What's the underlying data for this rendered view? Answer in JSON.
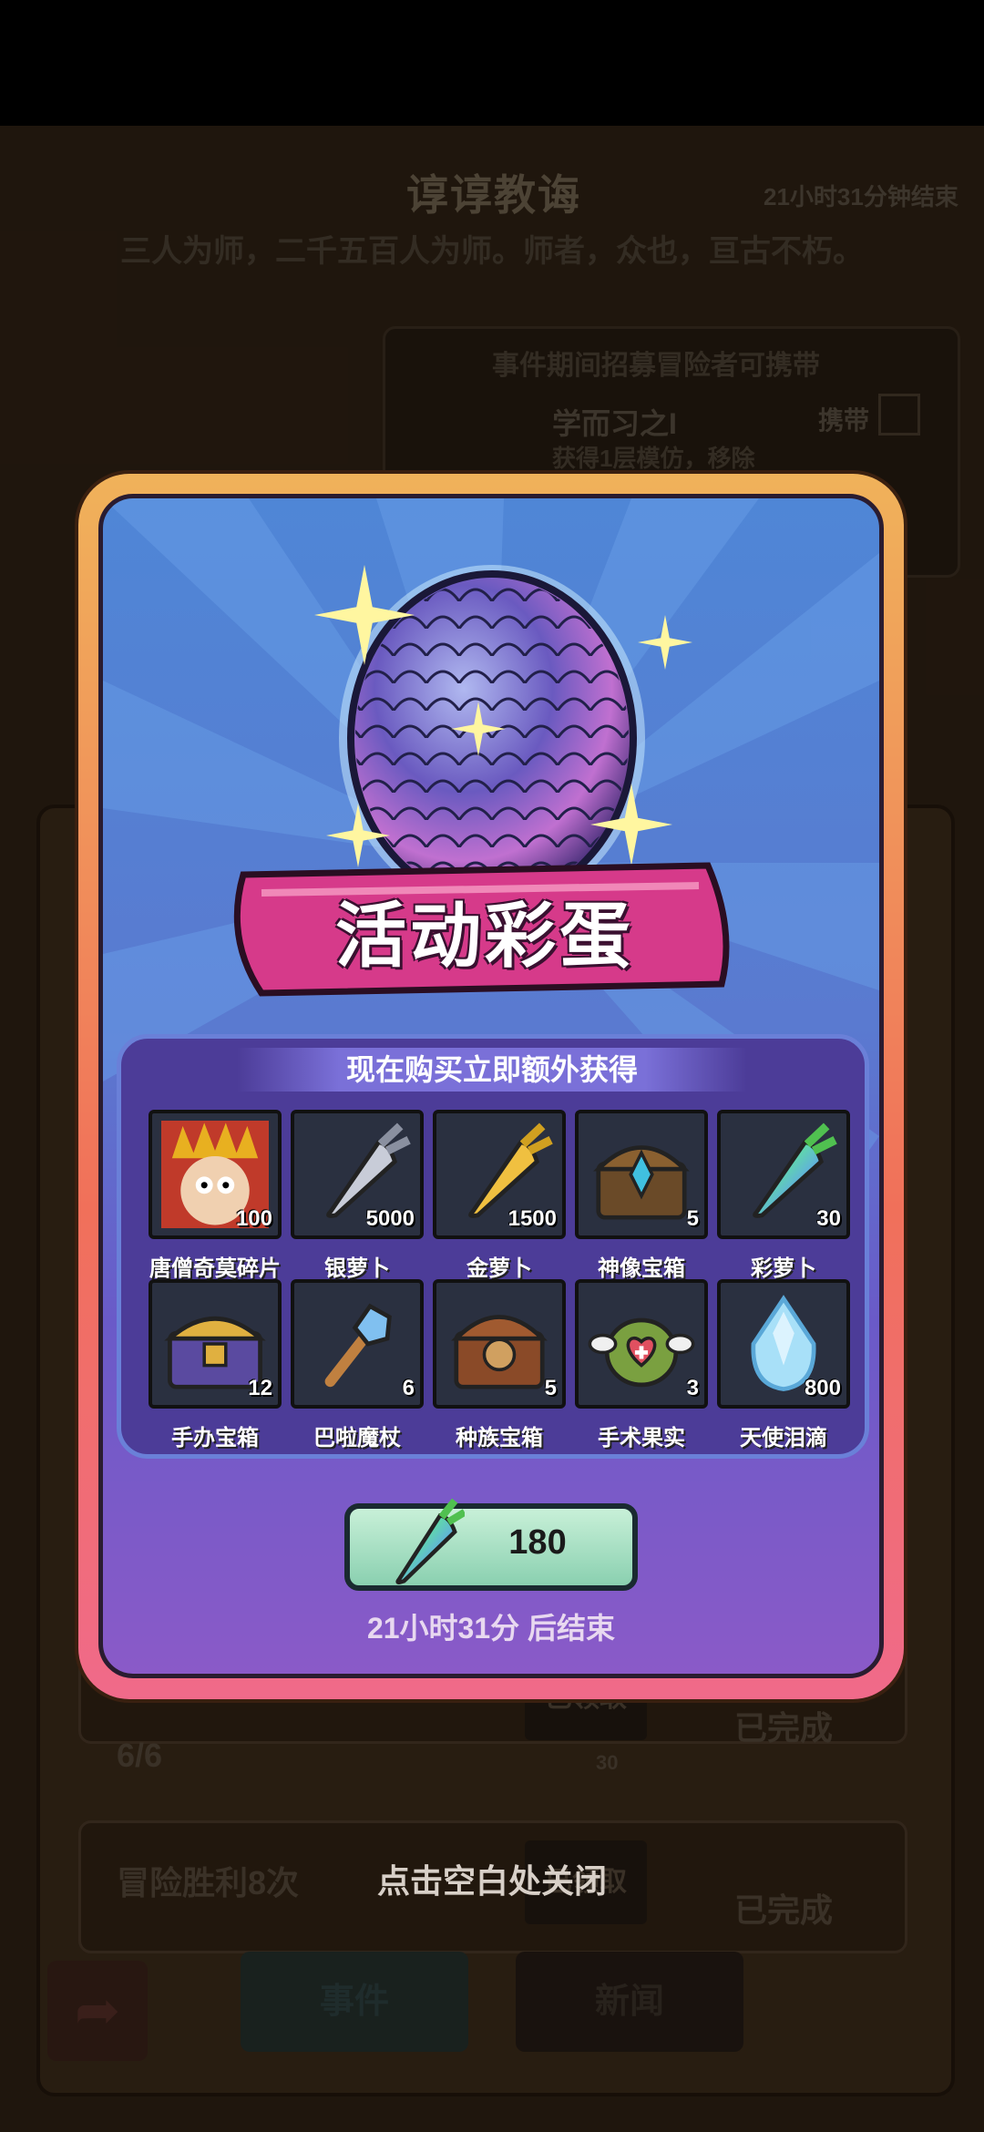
{
  "background": {
    "event_title": "谆谆教诲",
    "event_timer": "21小时31分钟结束",
    "event_subtitle": "三人为师，二千五百人为师。师者，众也，亘古不朽。",
    "panel_title": "事件期间招募冒险者可携带",
    "panel_item_name": "学而习之I",
    "panel_item_desc": "获得1层模仿，移除",
    "carry_label": "携带",
    "tasks": [
      {
        "progress": "6/6",
        "button": "已领取",
        "reward": "30",
        "status": "已完成"
      },
      {
        "title": "冒险胜利8次",
        "button": "已领取",
        "status": "已完成"
      }
    ],
    "tabs": [
      {
        "label": "事件"
      },
      {
        "label": "新闻"
      }
    ]
  },
  "popup": {
    "banner_title": "活动彩蛋",
    "rewards_header": "现在购买立即额外获得",
    "items": [
      {
        "name": "唐僧奇莫碎片",
        "count": "100",
        "icon": "tang-monk-portrait-icon"
      },
      {
        "name": "银萝卜",
        "count": "5000",
        "icon": "silver-carrot-icon"
      },
      {
        "name": "金萝卜",
        "count": "1500",
        "icon": "gold-carrot-icon"
      },
      {
        "name": "神像宝箱",
        "count": "5",
        "icon": "idol-chest-icon"
      },
      {
        "name": "彩萝卜",
        "count": "30",
        "icon": "rainbow-carrot-icon"
      },
      {
        "name": "手办宝箱",
        "count": "12",
        "icon": "figure-chest-icon"
      },
      {
        "name": "巴啦魔杖",
        "count": "6",
        "icon": "magic-wand-icon"
      },
      {
        "name": "种族宝箱",
        "count": "5",
        "icon": "race-chest-icon"
      },
      {
        "name": "手术果实",
        "count": "3",
        "icon": "surgery-fruit-icon"
      },
      {
        "name": "天使泪滴",
        "count": "800",
        "icon": "angel-tear-icon"
      }
    ],
    "price": "180",
    "price_icon": "rainbow-carrot-icon",
    "end_text": "21小时31分 后结束"
  },
  "close_hint": "点击空白处关闭",
  "colors": {
    "card_border": "#f0705a",
    "card_bg": "#5a7ad0",
    "banner": "#d63a8a",
    "buy_button": "#8ad0b0"
  }
}
